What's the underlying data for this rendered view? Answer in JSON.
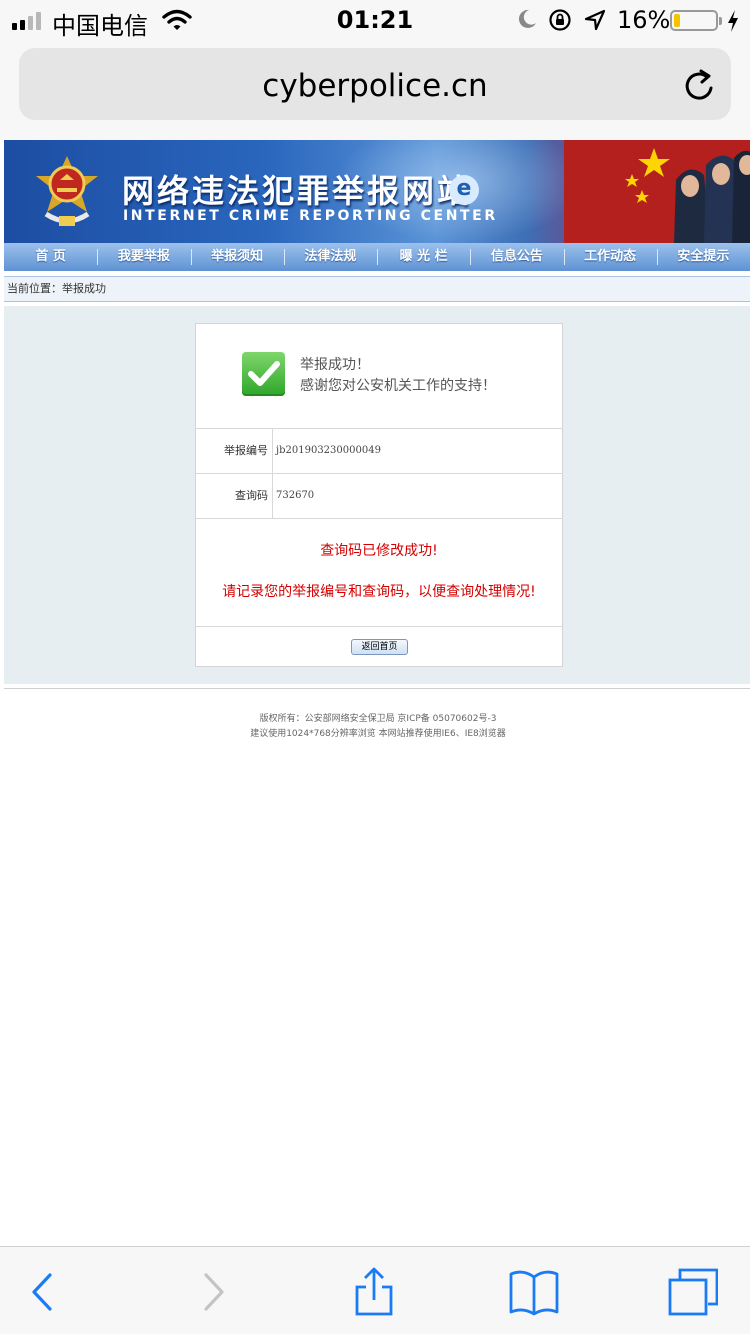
{
  "status_bar": {
    "carrier": "中国电信",
    "time": "01:21",
    "battery_percent": "16%",
    "battery_level": 0.16
  },
  "browser": {
    "url": "cyberpolice.cn"
  },
  "banner": {
    "title": "网络违法犯罪举报网站",
    "subtitle": "INTERNET CRIME REPORTING CENTER"
  },
  "nav": {
    "items": [
      "首 页",
      "我要举报",
      "举报须知",
      "法律法规",
      "曝 光 栏",
      "信息公告",
      "工作动态",
      "安全提示"
    ]
  },
  "breadcrumb": "当前位置：举报成功",
  "result": {
    "message_line1": "举报成功！",
    "message_line2": "感谢您对公安机关工作的支持！",
    "report_number_label": "举报编号",
    "report_number_value": "jb201903230000049",
    "query_code_label": "查询码",
    "query_code_value": "732670",
    "notice_line1": "查询码已修改成功!",
    "notice_line2": "请记录您的举报编号和查询码，以便查询处理情况!",
    "return_button": "返回首页"
  },
  "footer": {
    "line1": "版权所有：公安部网络安全保卫局 京ICP备 05070602号-3",
    "line2": "建议使用1024*768分辨率浏览 本网站推荐使用IE6、IE8浏览器"
  },
  "colors": {
    "nav_blue": "#5f92d3",
    "notice_red": "#d40000",
    "ios_blue": "#1a7bf5"
  }
}
